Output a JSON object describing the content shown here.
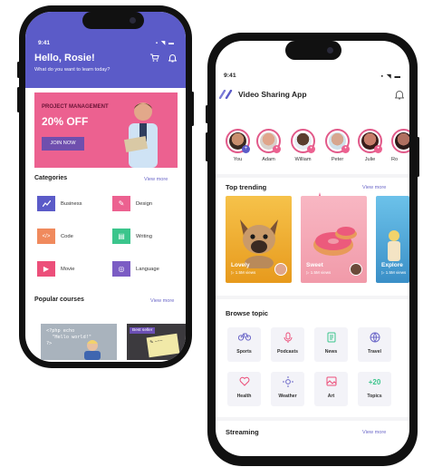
{
  "phone1": {
    "time": "9:41",
    "status_icons": "▪ ◥ ▬",
    "greeting": "Hello, Rosie!",
    "subtitle": "What do you want to learn today?",
    "cart_icon": "cart-icon",
    "cart_glyph": "🛒",
    "bell_glyph": "🔔",
    "promo": {
      "tag": "PROJECT MANAGEMENT",
      "headline": "20% OFF",
      "button": "JOIN NOW"
    },
    "categories_title": "Categories",
    "categories_link": "View more",
    "categories": [
      {
        "label": "Business",
        "color": "#5b5bc8",
        "glyph": "▁▃▆"
      },
      {
        "label": "Design",
        "color": "#ec6190",
        "glyph": "✎"
      },
      {
        "label": "Code",
        "color": "#f08a5d",
        "glyph": "</>"
      },
      {
        "label": "Writing",
        "color": "#3bc58c",
        "glyph": "▤"
      },
      {
        "label": "Movie",
        "color": "#ec4f7a",
        "glyph": "▶"
      },
      {
        "label": "Language",
        "color": "#7b5cc4",
        "glyph": "◎"
      }
    ],
    "courses_title": "Popular courses",
    "courses_link": "View more",
    "course_code": "<?php echo\n  \"Hello world!\"\n?>",
    "course_badge": "Best seller"
  },
  "phone2": {
    "time": "9:41",
    "status_icons": "▪ ◥ ▬",
    "app_title": "Video Sharing App",
    "logo": "//",
    "bell_glyph": "🔔",
    "stories": [
      {
        "name": "You",
        "skin": "#c98f6e",
        "badge": "+",
        "badge_color": "#5b5bc8"
      },
      {
        "name": "Adam",
        "skin": "#e0a58b",
        "badge": "●",
        "badge_color": "#ec6190"
      },
      {
        "name": "William",
        "skin": "#5a3d2e",
        "badge": "●",
        "badge_color": "#ec6190"
      },
      {
        "name": "Peter",
        "skin": "#d7a68f",
        "badge": "●",
        "badge_color": "#ec6190"
      },
      {
        "name": "Julie",
        "skin": "#c77d6a",
        "badge": "●",
        "badge_color": "#ec6190"
      },
      {
        "name": "Ro",
        "skin": "#b07060",
        "badge": "●",
        "badge_color": "#ec6190"
      }
    ],
    "trending_title": "Top trending",
    "trending_link": "View more",
    "trending": [
      {
        "title": "Lovely",
        "views": "▷ 1.5M views",
        "bg": "#f2b22e"
      },
      {
        "title": "Sweet",
        "views": "▷ 1.5M views",
        "bg": "#f4a6b4"
      },
      {
        "title": "Explore",
        "views": "▷ 1.5M views",
        "bg": "#4aa7d8"
      }
    ],
    "browse_title": "Browse topic",
    "topics": [
      {
        "label": "Sports",
        "glyph": "♁",
        "color": "#6b67c8"
      },
      {
        "label": "Podcasts",
        "glyph": "◍",
        "color": "#ec4f7a"
      },
      {
        "label": "News",
        "glyph": "▤",
        "color": "#3bc58c"
      },
      {
        "label": "Travel",
        "glyph": "⊕",
        "color": "#6b67c8"
      },
      {
        "label": "Health",
        "glyph": "♡",
        "color": "#ec4f7a"
      },
      {
        "label": "Weather",
        "glyph": "✲",
        "color": "#6b67c8"
      },
      {
        "label": "Art",
        "glyph": "▣",
        "color": "#ec4f7a"
      },
      {
        "label": "Topics",
        "glyph": "+20",
        "color": "#3bc58c"
      }
    ],
    "streaming_title": "Streaming",
    "streaming_link": "View more"
  },
  "colors": {
    "primary": "#5b5bc8",
    "pink": "#ec6190",
    "link": "#6b67c8"
  }
}
